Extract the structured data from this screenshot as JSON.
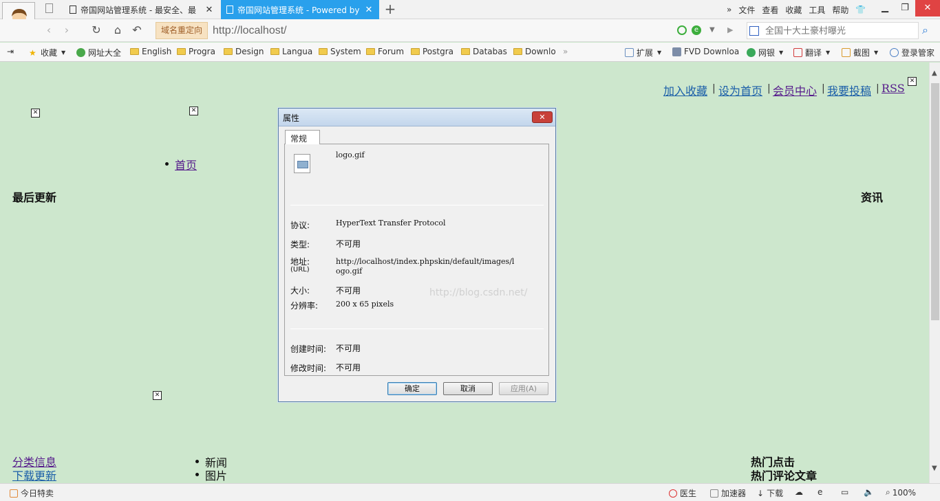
{
  "tabs": [
    {
      "title": "帝国网站管理系统 - 最安全、最"
    },
    {
      "title": "帝国网站管理系统 - Powered by"
    }
  ],
  "menu": [
    "文件",
    "查看",
    "收藏",
    "工具",
    "帮助"
  ],
  "navbar": {
    "redirect_label": "域名重定向",
    "url": "http://localhost/",
    "search_placeholder": "全国十大土豪村曝光"
  },
  "bookmarks": [
    {
      "label": "收藏"
    },
    {
      "label": "网址大全"
    },
    {
      "label": "English"
    },
    {
      "label": "Progra"
    },
    {
      "label": "Design"
    },
    {
      "label": "Langua"
    },
    {
      "label": "System"
    },
    {
      "label": "Forum"
    },
    {
      "label": "Postgra"
    },
    {
      "label": "Databas"
    },
    {
      "label": "Downlo"
    },
    {
      "label": "扩展"
    },
    {
      "label": "FVD Downloa"
    },
    {
      "label": "网银"
    },
    {
      "label": "翻译"
    },
    {
      "label": "截图"
    },
    {
      "label": "登录管家"
    }
  ],
  "page": {
    "top_links": [
      "加入收藏",
      "设为首页",
      "会员中心",
      "我要投稿",
      "RSS"
    ],
    "home_link": "首页",
    "latest_heading": "最后更新",
    "news_heading": "资讯",
    "classified_link": "分类信息",
    "download_link": "下载更新",
    "list_items": [
      "新闻",
      "图片"
    ],
    "hot_click": "热门点击",
    "hot_comment": "热门评论文章",
    "colors": {
      "visited_link": "#551a8b",
      "link": "#1a5ea8",
      "background": "#cde7cd"
    }
  },
  "dialog": {
    "title": "属性",
    "tab": "常规",
    "filename": "logo.gif",
    "protocol_label": "协议:",
    "protocol_value": "HyperText Transfer Protocol",
    "type_label": "类型:",
    "type_value": "不可用",
    "address_label": "地址:",
    "address_sub": "(URL)",
    "address_value_1": "http://localhost/index.phpskin/default/images/l",
    "address_value_2": "ogo.gif",
    "size_label": "大小:",
    "size_value": "不可用",
    "resolution_label": "分辨率:",
    "resolution_value": "200 x 65 pixels",
    "created_label": "创建时间:",
    "created_value": "不可用",
    "modified_label": "修改时间:",
    "modified_value": "不可用",
    "watermark": "http://blog.csdn.net/",
    "ok": "确定",
    "cancel": "取消",
    "apply": "应用(A)"
  },
  "statusbar": {
    "deals": "今日特卖",
    "doctor": "医生",
    "accelerator": "加速器",
    "download": "下载",
    "zoom": "100%"
  }
}
